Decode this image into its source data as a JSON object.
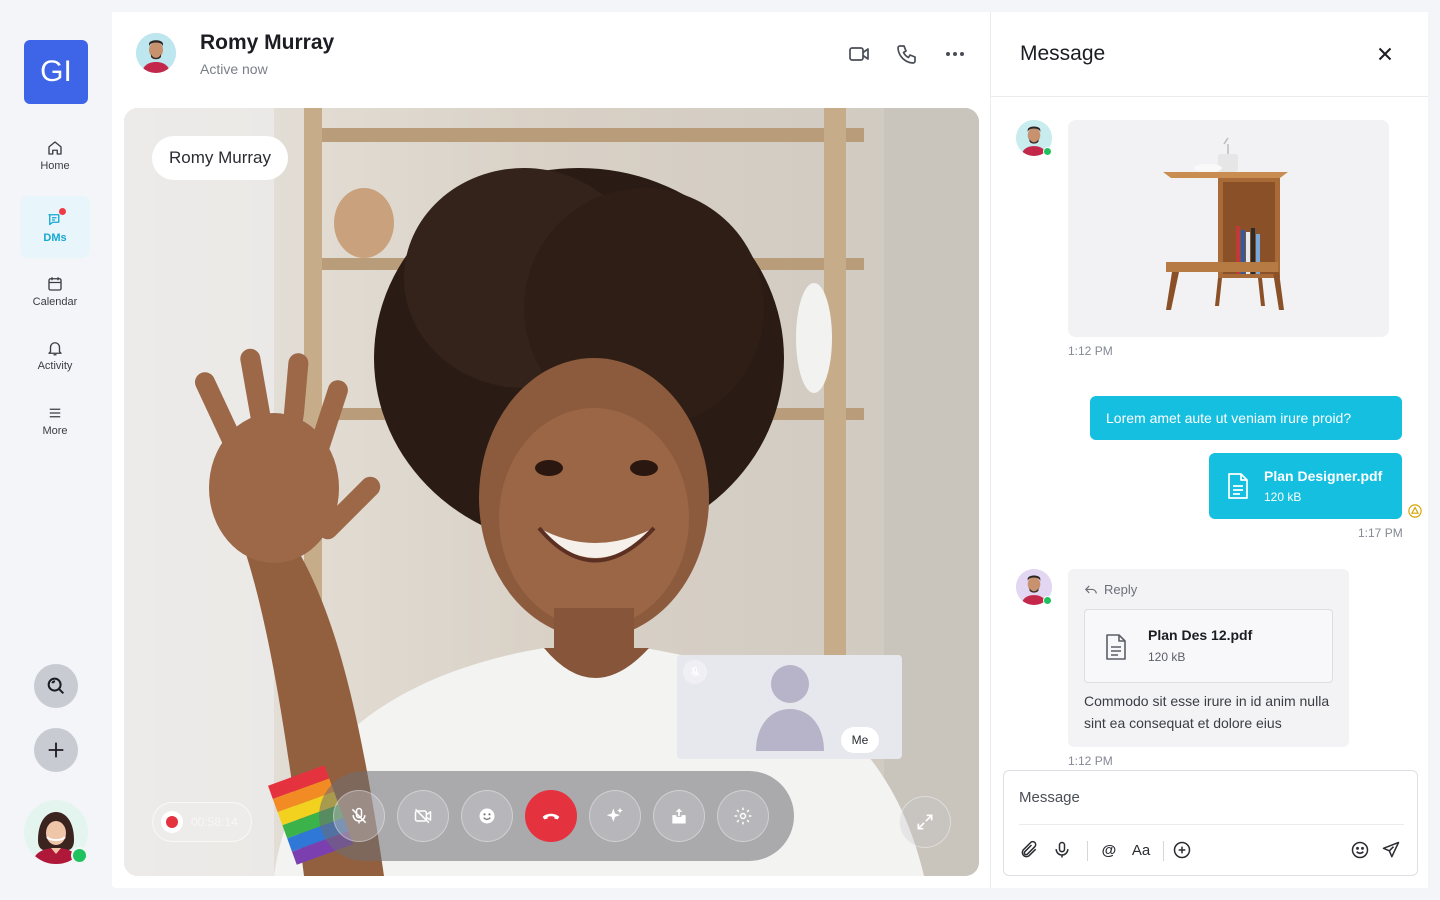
{
  "sidebar": {
    "logo_text": "GI",
    "items": [
      {
        "label": "Home",
        "icon": "home-icon"
      },
      {
        "label": "DMs",
        "icon": "chat-icon",
        "active": true,
        "unread": true
      },
      {
        "label": "Calendar",
        "icon": "calendar-icon"
      },
      {
        "label": "Activity",
        "icon": "bell-icon"
      },
      {
        "label": "More",
        "icon": "menu-icon"
      }
    ],
    "search_icon": "search-icon",
    "add_icon": "plus-icon",
    "user_status": "online"
  },
  "header": {
    "name": "Romy Murray",
    "status": "Active now",
    "actions": [
      "video-icon",
      "phone-icon",
      "more-icon"
    ]
  },
  "call": {
    "participant_name": "Romy Murray",
    "self_label": "Me",
    "recording_time": "00:58:14",
    "controls": [
      "mic-off-icon",
      "video-off-icon",
      "emoji-icon",
      "end-call-icon",
      "effects-icon",
      "share-icon",
      "settings-icon"
    ],
    "end_call_color": "#e5323f"
  },
  "panel": {
    "title": "Message",
    "messages": [
      {
        "type": "image",
        "direction": "in",
        "time": "1:12 PM"
      },
      {
        "type": "text",
        "direction": "out",
        "text": "Lorem amet aute ut veniam irure proid?"
      },
      {
        "type": "file",
        "direction": "out",
        "name": "Plan Designer.pdf",
        "size": "120 kB",
        "time": "1:17 PM"
      },
      {
        "type": "reply",
        "direction": "in",
        "reply_label": "Reply",
        "file_name": "Plan Des 12.pdf",
        "file_size": "120 kB",
        "text": "Commodo sit esse irure in id anim nulla sint ea consequat et dolore eius",
        "time": "1:12 PM"
      }
    ],
    "composer_placeholder": "Message",
    "accent": "#14bfe0"
  }
}
